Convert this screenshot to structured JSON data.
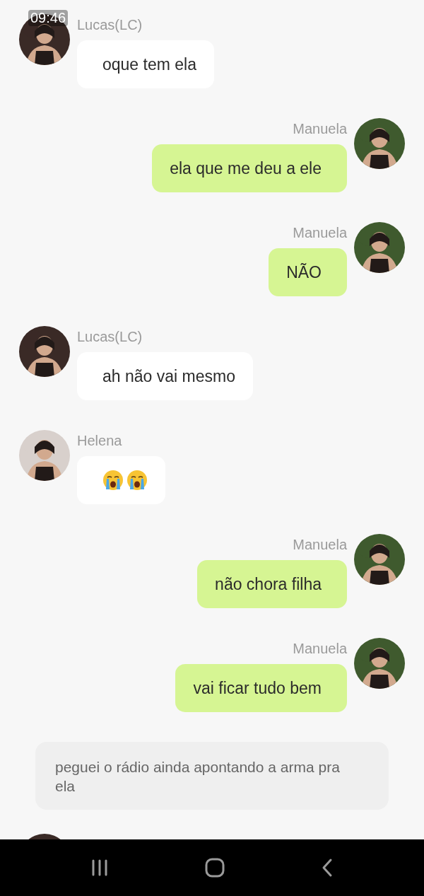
{
  "status_bar": {
    "time": "09:46"
  },
  "messages": [
    {
      "kind": "text",
      "outgoing": false,
      "sender": "Lucas(LC)",
      "avatar": {
        "kind": "picture",
        "color": "#3a2a26"
      },
      "text": "oque tem ela"
    },
    {
      "kind": "text",
      "outgoing": true,
      "sender": "Manuela",
      "avatar": {
        "kind": "picture",
        "color": "#3f5a2e"
      },
      "text": "ela que me deu a ele"
    },
    {
      "kind": "text",
      "outgoing": true,
      "sender": "Manuela",
      "avatar": {
        "kind": "picture",
        "color": "#3f5a2e"
      },
      "text": "NÃO"
    },
    {
      "kind": "text",
      "outgoing": false,
      "sender": "Lucas(LC)",
      "avatar": {
        "kind": "picture",
        "color": "#3a2a26"
      },
      "text": "ah não vai mesmo"
    },
    {
      "kind": "emoji",
      "outgoing": false,
      "sender": "Helena",
      "avatar": {
        "kind": "picture",
        "color": "#d8d0cc"
      },
      "emojis": [
        {
          "kind": "loudly-crying"
        },
        {
          "kind": "loudly-crying"
        }
      ]
    },
    {
      "kind": "text",
      "outgoing": true,
      "sender": "Manuela",
      "avatar": {
        "kind": "picture",
        "color": "#3f5a2e"
      },
      "text": "não chora filha"
    },
    {
      "kind": "text",
      "outgoing": true,
      "sender": "Manuela",
      "avatar": {
        "kind": "picture",
        "color": "#3f5a2e"
      },
      "text": "vai ficar tudo bem"
    },
    {
      "kind": "narration",
      "text": "peguei o rádio ainda apontando a arma pra ela"
    },
    {
      "kind": "partial",
      "avatar": {
        "kind": "picture",
        "color": "#3a2a26"
      }
    }
  ],
  "nav_bar": {
    "buttons": [
      {
        "kind": "recents"
      },
      {
        "kind": "home"
      },
      {
        "kind": "back"
      }
    ]
  }
}
